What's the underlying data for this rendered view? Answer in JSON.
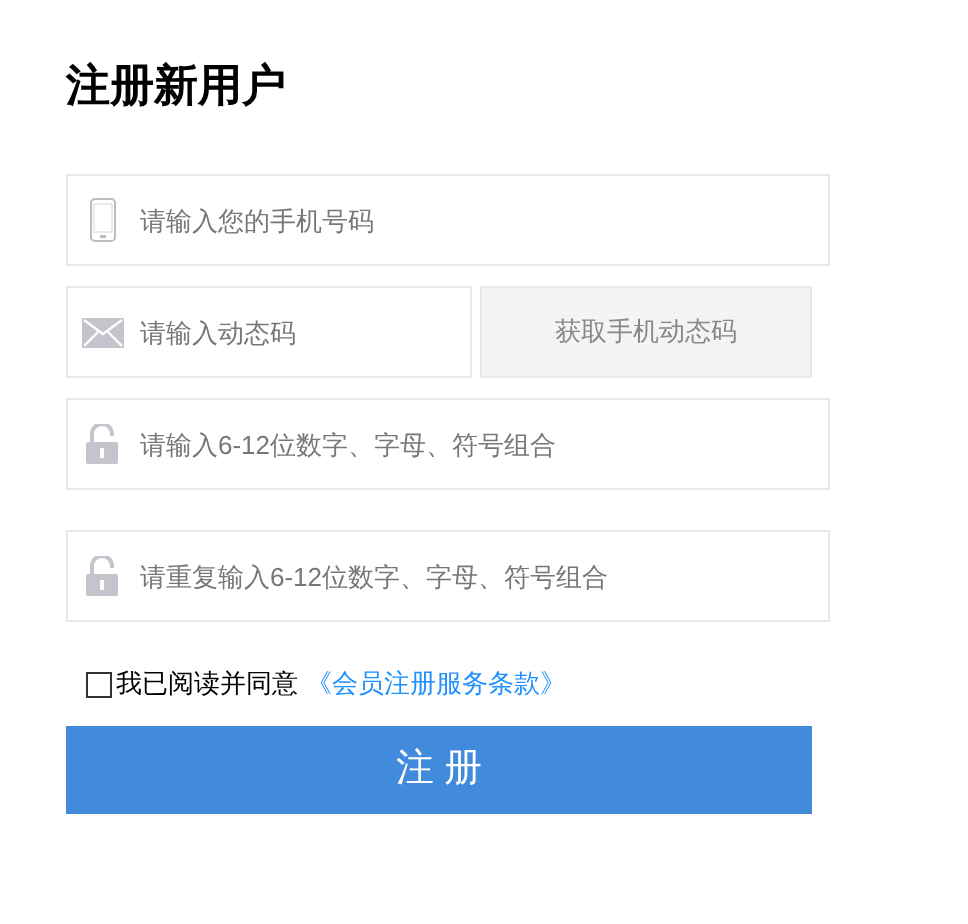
{
  "title": "注册新用户",
  "phone": {
    "kind": "phone",
    "placeholder": "请输入您的手机号码"
  },
  "code": {
    "kind": "mail",
    "placeholder": "请输入动态码",
    "button": "获取手机动态码"
  },
  "passwords": [
    {
      "kind": "lock",
      "placeholder": "请输入6-12位数字、字母、符号组合"
    },
    {
      "kind": "lock",
      "placeholder": "请重复输入6-12位数字、字母、符号组合"
    }
  ],
  "agree": {
    "checked": false,
    "label": "我已阅读并同意",
    "link": "《会员注册服务条款》"
  },
  "submit": "注 册"
}
